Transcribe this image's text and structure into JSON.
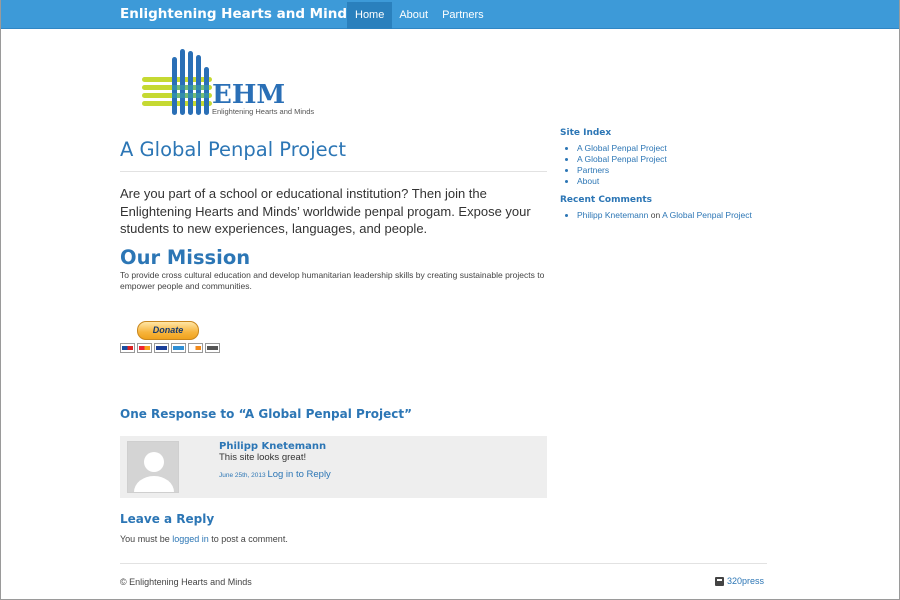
{
  "header": {
    "brand": "Enlightening Hearts and Minds",
    "nav": [
      {
        "label": "Home",
        "active": true
      },
      {
        "label": "About",
        "active": false
      },
      {
        "label": "Partners",
        "active": false
      }
    ]
  },
  "logo": {
    "text": "EHM",
    "tagline": "Enlightening Hearts and Minds"
  },
  "post": {
    "title": "A Global Penpal Project",
    "intro": "Are you part of a school or educational institution? Then join the Enlightening Hearts and Minds’ worldwide penpal progam.  Expose your students to new experiences, languages, and people.",
    "mission_title": "Our Mission",
    "mission_text": "To provide cross cultural education and develop humanitarian leadership skills by creating sustainable projects to empower people and communities.",
    "donate_label": "Donate"
  },
  "comments": {
    "heading": "One Response to “A Global Penpal Project”",
    "items": [
      {
        "author": "Philipp Knetemann",
        "text": "This site looks great!",
        "date": "June 25th, 2013",
        "reply_label": "Log in to Reply"
      }
    ]
  },
  "reply": {
    "heading": "Leave a Reply",
    "prefix": "You must be",
    "link": "logged in",
    "suffix": "to post a comment."
  },
  "sidebar": {
    "site_index_title": "Site Index",
    "site_index": [
      "A Global Penpal Project",
      "A Global Penpal Project",
      "Partners",
      "About"
    ],
    "recent_comments_title": "Recent Comments",
    "recent_comment": {
      "author": "Philipp Knetemann",
      "on": "on",
      "post": "A Global Penpal Project"
    }
  },
  "footer": {
    "copyright": "© Enlightening Hearts and Minds",
    "credit": "320press"
  },
  "colors": {
    "navbar": "#3d9ad8",
    "link": "#2c76b5",
    "logo_blue": "#2a6fb6",
    "logo_green": "#c5d932"
  }
}
